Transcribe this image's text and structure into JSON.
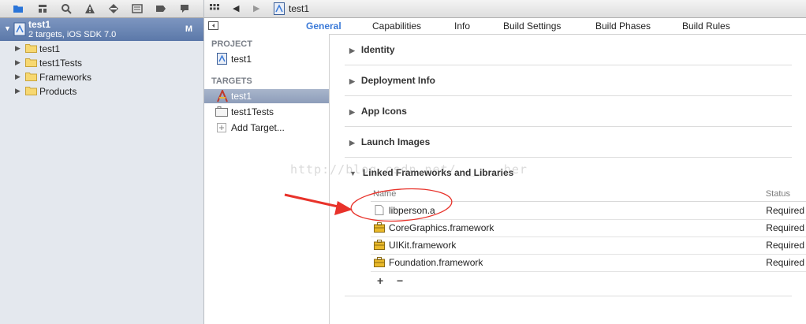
{
  "navigator": {
    "project_name": "test1",
    "project_subtitle": "2 targets, iOS SDK 7.0",
    "project_badge": "M",
    "items": [
      {
        "label": "test1"
      },
      {
        "label": "test1Tests"
      },
      {
        "label": "Frameworks"
      },
      {
        "label": "Products"
      }
    ]
  },
  "breadcrumb": {
    "project": "test1"
  },
  "tabs": [
    {
      "label": "General"
    },
    {
      "label": "Capabilities"
    },
    {
      "label": "Info"
    },
    {
      "label": "Build Settings"
    },
    {
      "label": "Build Phases"
    },
    {
      "label": "Build Rules"
    }
  ],
  "targets_panel": {
    "project_header": "PROJECT",
    "project_item": "test1",
    "targets_header": "TARGETS",
    "targets": [
      {
        "label": "test1"
      },
      {
        "label": "test1Tests"
      }
    ],
    "add_target": "Add Target..."
  },
  "sections": [
    {
      "label": "Identity"
    },
    {
      "label": "Deployment Info"
    },
    {
      "label": "App Icons"
    },
    {
      "label": "Launch Images"
    },
    {
      "label": "Linked Frameworks and Libraries"
    }
  ],
  "linked_table": {
    "columns": {
      "name": "Name",
      "status": "Status"
    },
    "rows": [
      {
        "name": "libperson.a",
        "status": "Required"
      },
      {
        "name": "CoreGraphics.framework",
        "status": "Required"
      },
      {
        "name": "UIKit.framework",
        "status": "Required"
      },
      {
        "name": "Foundation.framework",
        "status": "Required"
      }
    ],
    "add_label": "+",
    "remove_label": "−"
  },
  "watermark": "http://blog.csdn.net/ __ __her",
  "colors": {
    "accent": "#3b7ad8",
    "selection": "#5b78a9",
    "annotation": "#e8322a"
  }
}
